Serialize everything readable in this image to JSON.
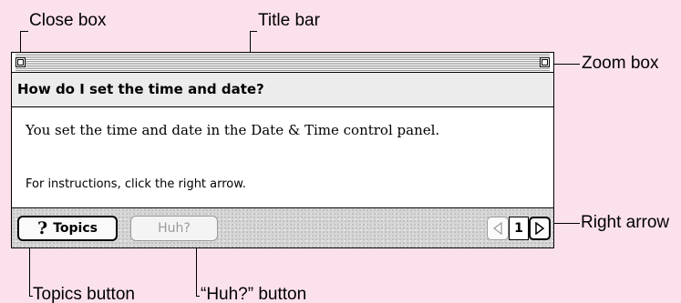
{
  "callouts": {
    "close_box": "Close box",
    "title_bar": "Title bar",
    "zoom_box": "Zoom box",
    "right_arrow": "Right arrow",
    "topics_button": "Topics button",
    "huh_button": "“Huh?” button"
  },
  "window": {
    "question": "How do I set the time and date?",
    "answer": "You set the time and date in the Date & Time control panel.",
    "instruction": "For instructions, click the right arrow.",
    "topics_qmark": "?",
    "topics_label": "Topics",
    "huh_label": "Huh?",
    "page_number": "1"
  },
  "icons": {
    "close_box": "close-box-icon",
    "zoom_box": "zoom-box-icon",
    "left_arrow": "triangle-left-icon",
    "right_arrow": "triangle-right-icon"
  },
  "colors": {
    "background": "#fbe1ec",
    "disabled": "#9a9a9a"
  }
}
